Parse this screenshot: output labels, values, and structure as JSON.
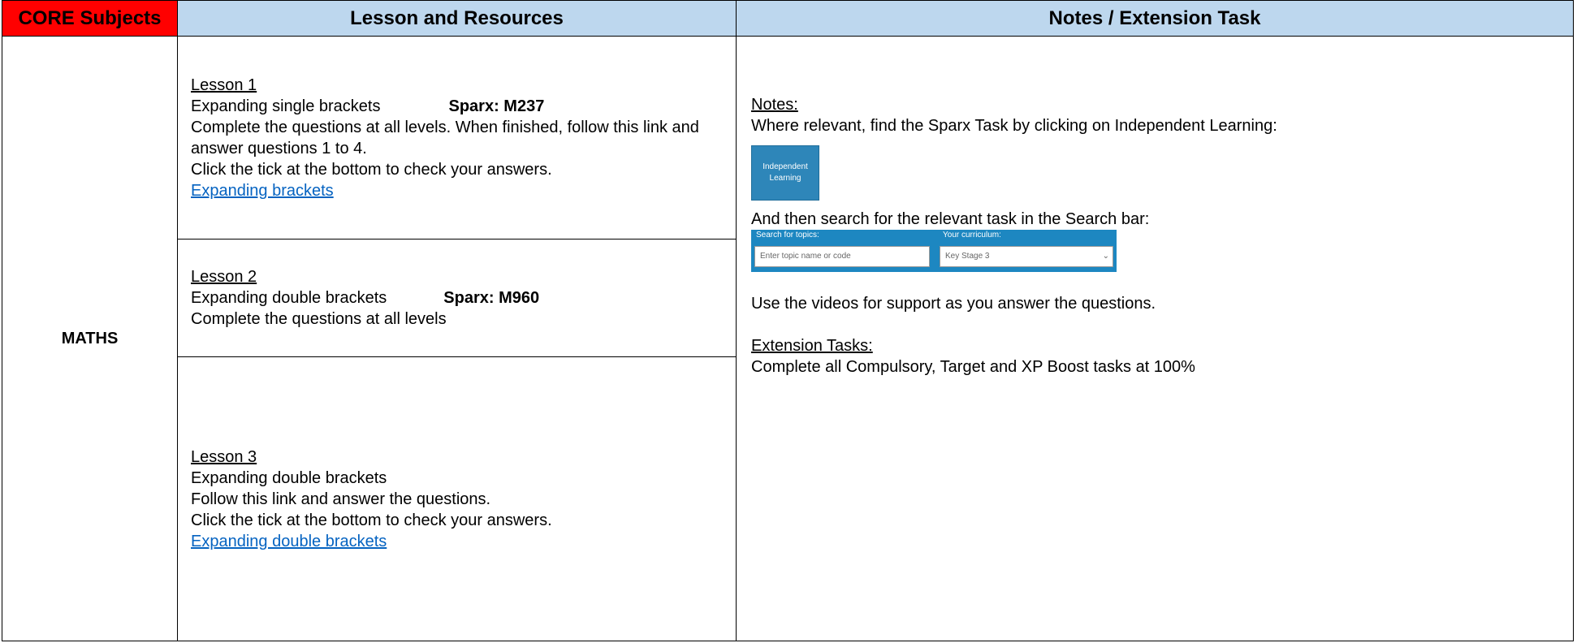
{
  "header": {
    "core": "CORE Subjects",
    "lesson": "Lesson and Resources",
    "notes": "Notes / Extension Task"
  },
  "subject": "MATHS",
  "lessons": [
    {
      "title": "Lesson 1",
      "topic": "Expanding single brackets",
      "code": "Sparx: M237",
      "lines": [
        "Complete the questions at all levels. When finished, follow this link and answer questions 1 to 4.",
        "Click the tick at the bottom to check your answers."
      ],
      "link": "Expanding brackets"
    },
    {
      "title": "Lesson 2",
      "topic": "Expanding double brackets",
      "code": "Sparx: M960",
      "lines": [
        "Complete the questions at all levels"
      ]
    },
    {
      "title": "Lesson 3",
      "topic": "Expanding double brackets",
      "lines": [
        "Follow this link and answer the questions.",
        "Click the tick at the bottom to check your answers."
      ],
      "link": "Expanding double brackets"
    }
  ],
  "notes": {
    "heading": "Notes:",
    "intro": "Where relevant, find the Sparx Task by clicking on Independent Learning:",
    "button_line1": "Independent",
    "button_line2": "Learning",
    "search_text": "And then search for the relevant task in the Search bar:",
    "search_label": "Search for topics:",
    "search_placeholder": "Enter topic name or code",
    "curriculum_label": "Your curriculum:",
    "curriculum_value": "Key Stage 3",
    "videos": "Use the videos for support as you answer the questions.",
    "ext_heading": "Extension Tasks:",
    "ext_text": "Complete all Compulsory, Target and XP Boost tasks at 100%"
  }
}
